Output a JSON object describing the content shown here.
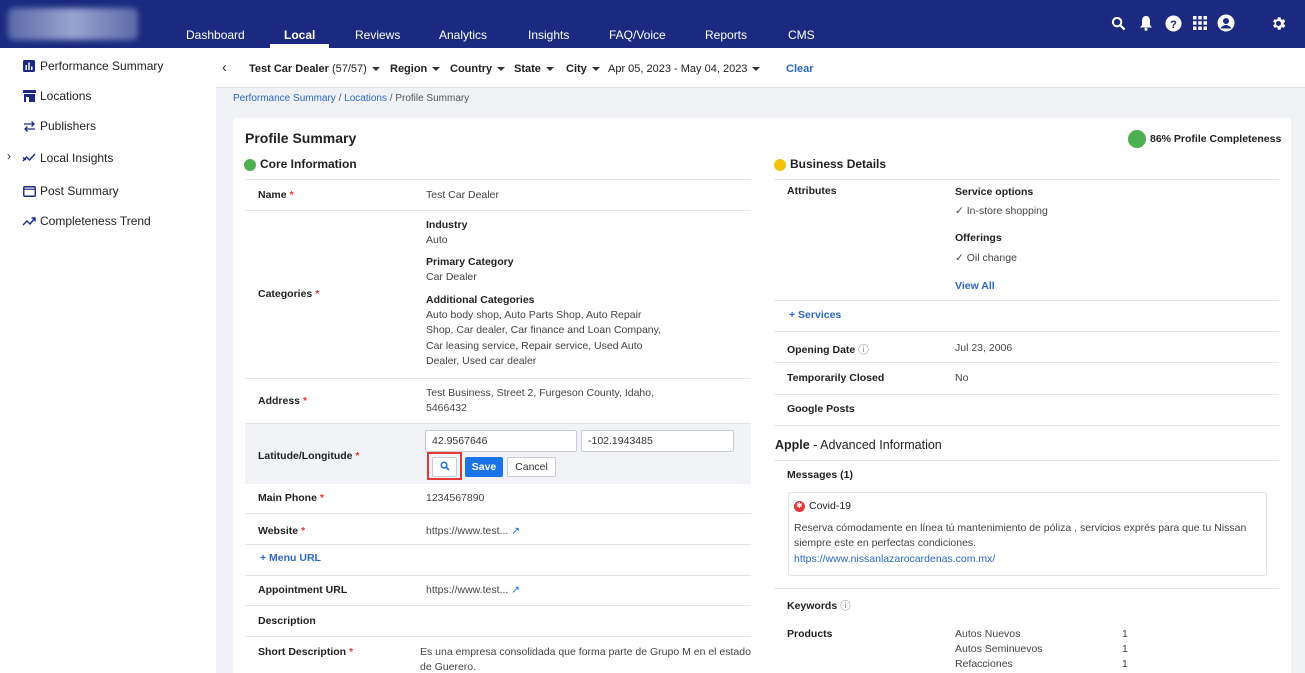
{
  "nav": {
    "items": [
      "Dashboard",
      "Local",
      "Reviews",
      "Analytics",
      "Insights",
      "FAQ/Voice",
      "Reports",
      "CMS"
    ],
    "active": "Local"
  },
  "topicons": [
    "search-icon",
    "bell-icon",
    "help-icon",
    "apps-grid-icon",
    "account-icon",
    "settings-gear-icon"
  ],
  "sidebar": {
    "items": [
      "Performance Summary",
      "Locations",
      "Publishers",
      "Local Insights",
      "Post Summary",
      "Completeness Trend"
    ]
  },
  "filters": {
    "location": "Test Car Dealer",
    "location_count": "(57/57)",
    "region": "Region",
    "country": "Country",
    "state": "State",
    "city": "City",
    "date_range": "Apr 05, 2023 - May 04, 2023",
    "clear": "Clear"
  },
  "breadcrumb": {
    "crumb1": "Performance Summary",
    "crumb2": "Locations",
    "crumb3": "Profile Summary",
    "sep": "/"
  },
  "profile": {
    "title": "Profile Summary",
    "completeness": "86% Profile Completeness"
  },
  "core": {
    "title": "Core Information",
    "name_label": "Name",
    "name_value": "Test Car Dealer",
    "categories_label": "Categories",
    "industry_label": "Industry",
    "industry_value": "Auto",
    "primary_label": "Primary Category",
    "primary_value": "Car Dealer",
    "additional_label": "Additional Categories",
    "additional_line1": "Auto body shop, Auto Parts Shop, Auto Repair",
    "additional_line2": "Shop, Car dealer, Car finance and Loan Company,",
    "additional_line3": "Car leasing service, Repair service, Used Auto",
    "additional_line4": "Dealer, Used car dealer",
    "address_label": "Address",
    "address_line1": "Test Business, Street 2, Furgeson County, Idaho,",
    "address_line2": "5466432",
    "latlng_label": "Latitude/Longitude",
    "latitude": "42.9567646",
    "longitude": "-102.1943485",
    "save": "Save",
    "cancel": "Cancel",
    "phone_label": "Main Phone",
    "phone_value": "1234567890",
    "website_label": "Website",
    "website_value": "https://www.test...",
    "menu_url": "+ Menu URL",
    "appointment_label": "Appointment URL",
    "appointment_value": "https://www.test...",
    "description_label": "Description",
    "short_desc_label": "Short Description",
    "short_desc_line1": "Es una empresa consolidada que forma parte de Grupo M en el estado",
    "short_desc_line2": "de Guerero."
  },
  "business": {
    "title": "Business Details",
    "attributes_label": "Attributes",
    "service_options_label": "Service options",
    "service_options_value": "✓ In-store shopping",
    "offerings_label": "Offerings",
    "offerings_value": "✓ Oil change",
    "view_all": "View All",
    "services": "+ Services",
    "opening_label": "Opening Date",
    "opening_value": "Jul 23, 2006",
    "temp_closed_label": "Temporarily Closed",
    "temp_closed_value": "No",
    "google_posts_label": "Google Posts"
  },
  "apple": {
    "title_bold": "Apple",
    "title_rest": " - Advanced Information",
    "messages_label": "Messages (1)",
    "message_title": "Covid-19",
    "message_line1": "Reserva cómodamente en línea tú mantenimiento de póliza , servicios exprés para que tu Nissan",
    "message_line2": "siempre este en perfectas condiciones.",
    "message_link": "https://www.nissanlazarocardenas.com.mx/",
    "keywords_label": "Keywords",
    "products_label": "Products",
    "products": [
      {
        "name": "Autos Nuevos",
        "count": "1"
      },
      {
        "name": "Autos Seminuevos",
        "count": "1"
      },
      {
        "name": "Refacciones",
        "count": "1"
      }
    ]
  },
  "colors": {
    "nav_bg": "#1b2a80",
    "accent": "#1a73e8",
    "green": "#4caf50",
    "yellow": "#f4c20d",
    "required": "#e53935",
    "highlight": "#e53935"
  }
}
